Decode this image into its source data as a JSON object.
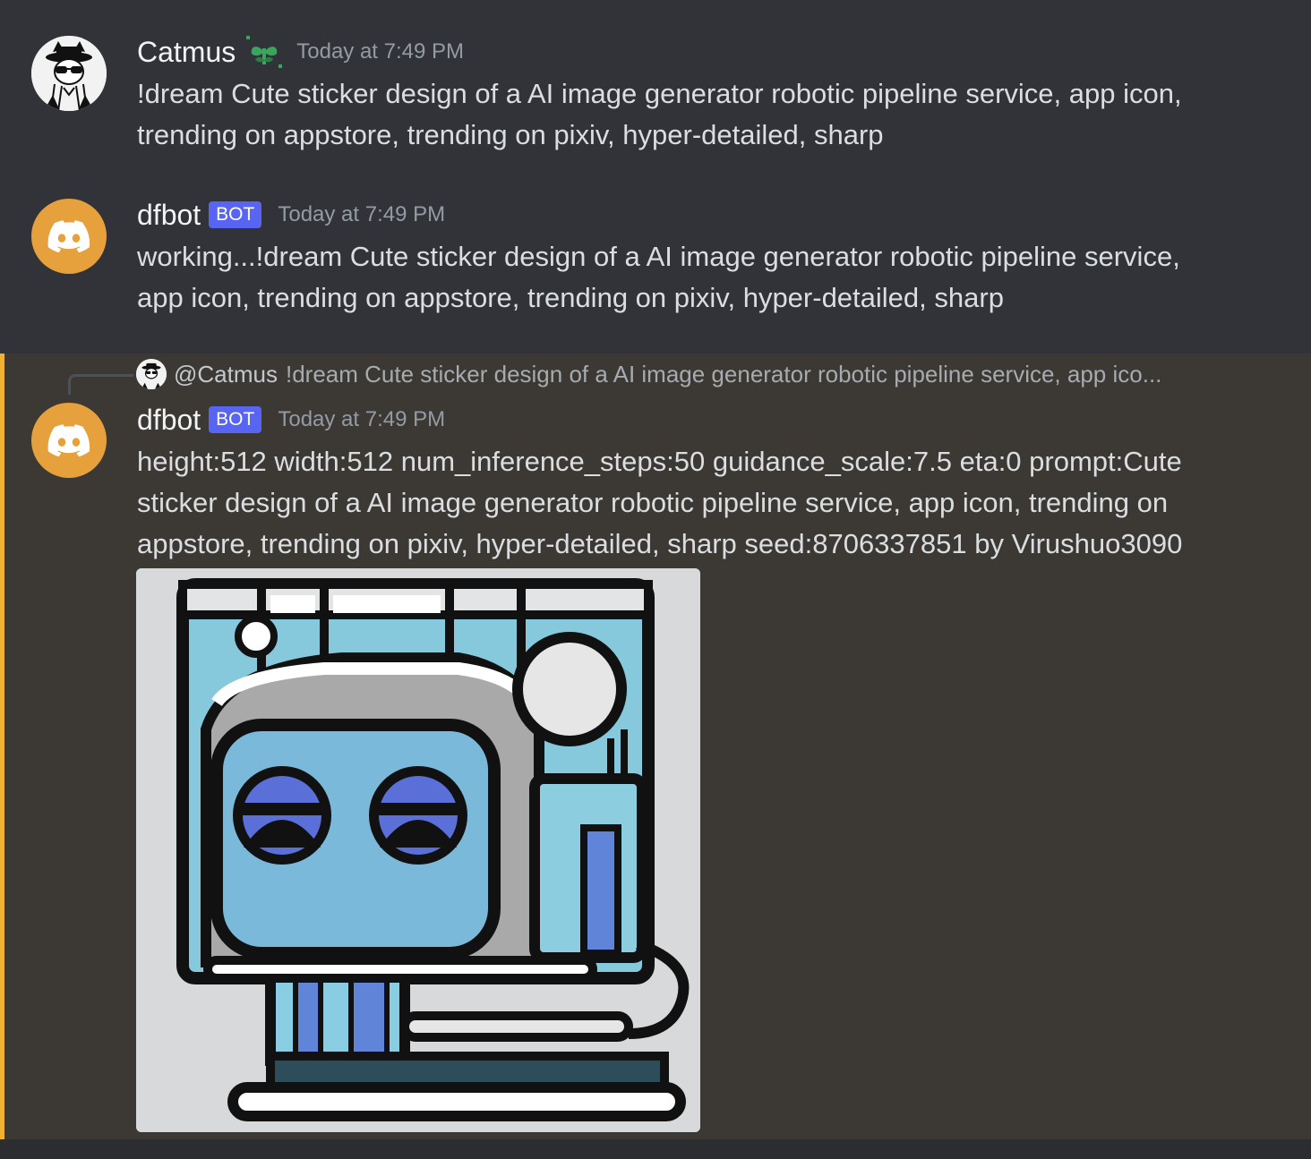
{
  "messages": [
    {
      "username": "Catmus",
      "badge_icon": "sprout-icon",
      "timestamp": "Today at 7:49 PM",
      "text": "!dream Cute sticker design of a AI image generator robotic pipeline service, app icon, trending on appstore, trending on pixiv, hyper-detailed, sharp"
    },
    {
      "username": "dfbot",
      "tag": "BOT",
      "timestamp": "Today at 7:49 PM",
      "text": "working...!dream Cute sticker design of a AI image generator robotic pipeline service, app icon, trending on appstore, trending on pixiv, hyper-detailed, sharp"
    },
    {
      "username": "dfbot",
      "tag": "BOT",
      "timestamp": "Today at 7:49 PM",
      "reply": {
        "mention": "@Catmus",
        "preview": "!dream Cute sticker design of a AI image generator robotic pipeline service, app ico..."
      },
      "text": "height:512 width:512 num_inference_steps:50 guidance_scale:7.5 eta:0 prompt:Cute sticker design of a AI image generator robotic pipeline service, app icon, trending on appstore, trending on pixiv, hyper-detailed, sharp seed:8706337851  by Virushuo3090",
      "attachment": "robot-sticker-image"
    }
  ],
  "colors": {
    "background": "#313338",
    "highlight_background": "#3c3935",
    "highlight_bar": "#f0b232",
    "bot_tag": "#5865f2",
    "bot_avatar": "#e6a03c",
    "timestamp": "#949ba4",
    "text": "#dbdee1"
  }
}
